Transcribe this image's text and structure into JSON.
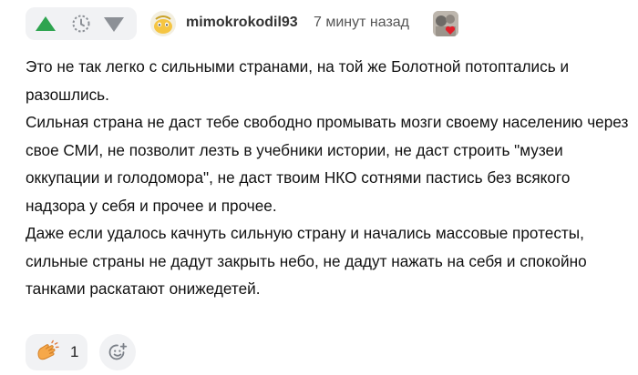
{
  "comment": {
    "author": "mimokrokodil93",
    "time": "7 минут назад",
    "paragraphs": [
      "Это не так легко с сильными странами, на той же Болотной потоптались и разошлись.",
      "Сильная страна не даст тебе свободно промывать мозги своему населению через свое СМИ, не позволит лезть в учебники истории, не даст строить \"музеи оккупации и голодомора\", не даст твоим НКО сотнями пастись без всякого надзора у себя и прочее и прочее.",
      "Даже если удалось качнуть сильную страну и начались массовые протесты, сильные страны не дадут закрыть небо, не дадут нажать на себя и спокойно танками раскатают онижедетей."
    ]
  },
  "votes": {
    "up_icon": "arrow-up",
    "middle_icon": "clock",
    "down_icon": "arrow-down"
  },
  "reactions": {
    "items": [
      {
        "icon": "clapping-hands",
        "count": "1"
      }
    ],
    "add_icon": "smiley-plus"
  },
  "colors": {
    "upvote": "#2ea44f",
    "pill_bg": "#f1f2f4",
    "muted": "#8c9096"
  }
}
